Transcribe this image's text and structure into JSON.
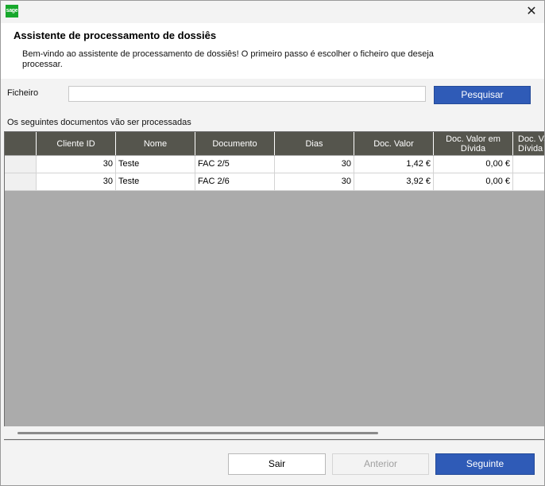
{
  "window": {
    "logo_text": "sage",
    "close_glyph": "✕"
  },
  "header": {
    "title": "Assistente de processamento de dossiês",
    "description": "Bem-vindo ao assistente de processamento de dossiês! O primeiro passo é escolher o ficheiro que deseja processar."
  },
  "file": {
    "label": "Ficheiro",
    "value": "",
    "search_label": "Pesquisar"
  },
  "documents": {
    "label": "Os seguintes documentos vão ser processadas",
    "columns": [
      "Cliente ID",
      "Nome",
      "Documento",
      "Dias",
      "Doc. Valor",
      "Doc. Valor em Dívida",
      "Doc. Valor em Dívida"
    ],
    "rows": [
      [
        "30",
        "Teste",
        "FAC 2/5",
        "30",
        "1,42 €",
        "0,00 €",
        ""
      ],
      [
        "30",
        "Teste",
        "FAC 2/6",
        "30",
        "3,92 €",
        "0,00 €",
        ""
      ]
    ]
  },
  "footer": {
    "exit_label": "Sair",
    "previous_label": "Anterior",
    "next_label": "Seguinte"
  },
  "colors": {
    "accent": "#2f5bb7",
    "grid_header": "#55554d",
    "grid_empty": "#ababab"
  }
}
